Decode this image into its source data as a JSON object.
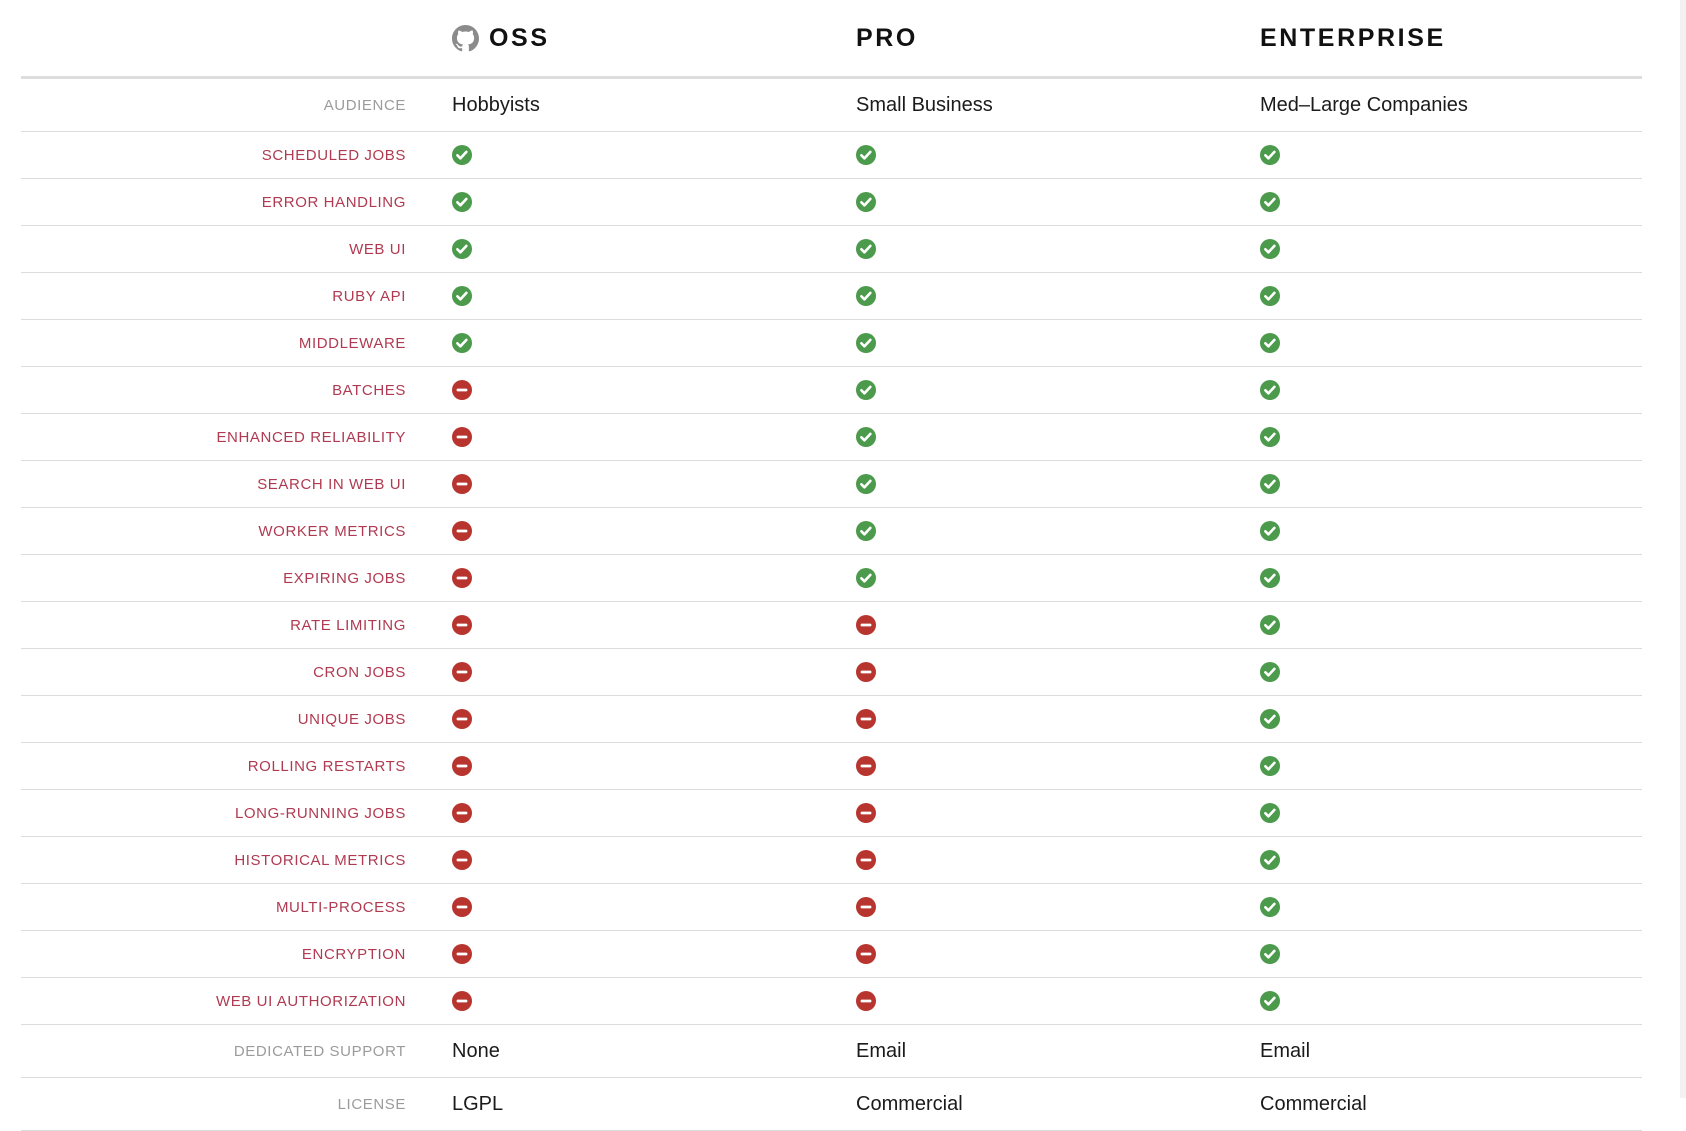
{
  "colors": {
    "check": "#4c9a4c",
    "cross": "#b8352f",
    "row_label": "#b03a51",
    "row_label_muted": "#9b9b9b",
    "rule": "#dcdcdc",
    "header_text": "#111111",
    "value_text": "#1b1b1b"
  },
  "header": {
    "label_col": "",
    "plans": [
      {
        "name": "OSS",
        "icon": "github-icon"
      },
      {
        "name": "PRO",
        "icon": null
      },
      {
        "name": "ENTERPRISE",
        "icon": null
      }
    ]
  },
  "rows": [
    {
      "label": "AUDIENCE",
      "muted": true,
      "type": "text",
      "values": [
        "Hobbyists",
        "Small Business",
        "Med–Large Companies"
      ]
    },
    {
      "label": "SCHEDULED JOBS",
      "muted": false,
      "type": "icon",
      "values": [
        "check",
        "check",
        "check"
      ]
    },
    {
      "label": "ERROR HANDLING",
      "muted": false,
      "type": "icon",
      "values": [
        "check",
        "check",
        "check"
      ]
    },
    {
      "label": "WEB UI",
      "muted": false,
      "type": "icon",
      "values": [
        "check",
        "check",
        "check"
      ]
    },
    {
      "label": "RUBY API",
      "muted": false,
      "type": "icon",
      "values": [
        "check",
        "check",
        "check"
      ]
    },
    {
      "label": "MIDDLEWARE",
      "muted": false,
      "type": "icon",
      "values": [
        "check",
        "check",
        "check"
      ]
    },
    {
      "label": "BATCHES",
      "muted": false,
      "type": "icon",
      "values": [
        "cross",
        "check",
        "check"
      ]
    },
    {
      "label": "ENHANCED RELIABILITY",
      "muted": false,
      "type": "icon",
      "values": [
        "cross",
        "check",
        "check"
      ]
    },
    {
      "label": "SEARCH IN WEB UI",
      "muted": false,
      "type": "icon",
      "values": [
        "cross",
        "check",
        "check"
      ]
    },
    {
      "label": "WORKER METRICS",
      "muted": false,
      "type": "icon",
      "values": [
        "cross",
        "check",
        "check"
      ]
    },
    {
      "label": "EXPIRING JOBS",
      "muted": false,
      "type": "icon",
      "values": [
        "cross",
        "check",
        "check"
      ]
    },
    {
      "label": "RATE LIMITING",
      "muted": false,
      "type": "icon",
      "values": [
        "cross",
        "cross",
        "check"
      ]
    },
    {
      "label": "CRON JOBS",
      "muted": false,
      "type": "icon",
      "values": [
        "cross",
        "cross",
        "check"
      ]
    },
    {
      "label": "UNIQUE JOBS",
      "muted": false,
      "type": "icon",
      "values": [
        "cross",
        "cross",
        "check"
      ]
    },
    {
      "label": "ROLLING RESTARTS",
      "muted": false,
      "type": "icon",
      "values": [
        "cross",
        "cross",
        "check"
      ]
    },
    {
      "label": "LONG-RUNNING JOBS",
      "muted": false,
      "type": "icon",
      "values": [
        "cross",
        "cross",
        "check"
      ]
    },
    {
      "label": "HISTORICAL METRICS",
      "muted": false,
      "type": "icon",
      "values": [
        "cross",
        "cross",
        "check"
      ]
    },
    {
      "label": "MULTI-PROCESS",
      "muted": false,
      "type": "icon",
      "values": [
        "cross",
        "cross",
        "check"
      ]
    },
    {
      "label": "ENCRYPTION",
      "muted": false,
      "type": "icon",
      "values": [
        "cross",
        "cross",
        "check"
      ]
    },
    {
      "label": "WEB UI AUTHORIZATION",
      "muted": false,
      "type": "icon",
      "values": [
        "cross",
        "cross",
        "check"
      ]
    },
    {
      "label": "DEDICATED SUPPORT",
      "muted": true,
      "type": "text",
      "values": [
        "None",
        "Email",
        "Email"
      ]
    },
    {
      "label": "LICENSE",
      "muted": true,
      "type": "text",
      "values": [
        "LGPL",
        "Commercial",
        "Commercial"
      ]
    }
  ]
}
